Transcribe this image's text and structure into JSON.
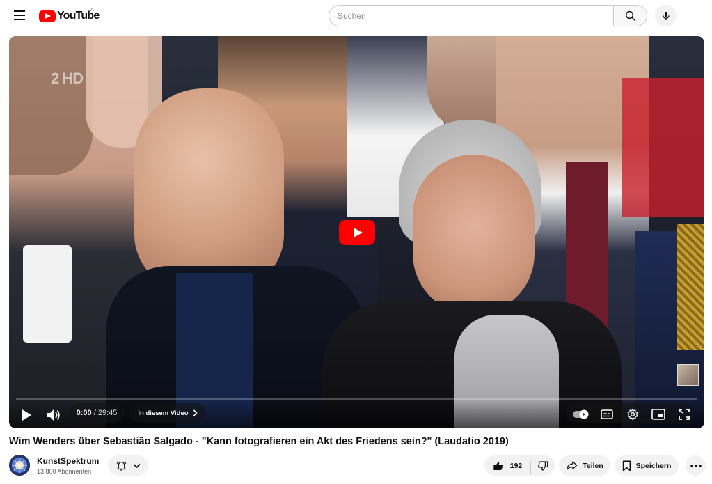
{
  "header": {
    "logo_text": "YouTube",
    "country_code": "AT",
    "search_placeholder": "Suchen",
    "icons": [
      "menu-icon",
      "search-icon",
      "microphone-icon"
    ]
  },
  "player": {
    "watermark": "2 HD",
    "current_time": "0:00",
    "separator": " / ",
    "duration": "29:45",
    "chapter_button_label": "In diesem Video",
    "progress": 0,
    "icons": [
      "play-icon",
      "volume-icon",
      "autoplay-toggle-icon",
      "subtitles-icon",
      "settings-icon",
      "miniplayer-icon",
      "fullscreen-icon"
    ]
  },
  "video": {
    "title": "Wim Wenders über Sebastião Salgado - \"Kann fotografieren ein Akt des Friedens sein?\" (Laudatio 2019)"
  },
  "channel": {
    "name": "KunstSpektrum",
    "subscribers": "13.800 Abonnenten"
  },
  "actions": {
    "like_count": "192",
    "share_label": "Teilen",
    "save_label": "Speichern"
  },
  "colors": {
    "brand_red": "#ff0000",
    "text_primary": "#0f0f0f",
    "text_secondary": "#606060",
    "button_bg": "#f2f2f2"
  }
}
